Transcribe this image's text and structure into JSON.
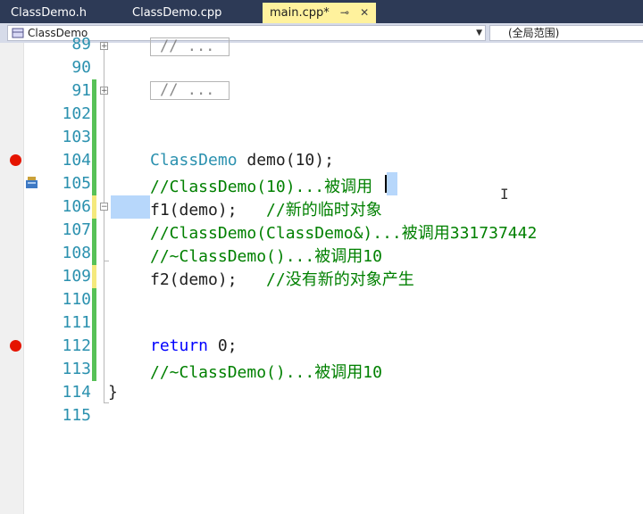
{
  "tabs": [
    {
      "label": "ClassDemo.h"
    },
    {
      "label": "ClassDemo.cpp"
    },
    {
      "label": "main.cpp*",
      "pin": "⊸",
      "close": "✕"
    }
  ],
  "nav": {
    "class_combo": "ClassDemo",
    "scope_combo": "(全局范围)"
  },
  "lines": {
    "l89": {
      "num": "89",
      "box": "// ..."
    },
    "l90": {
      "num": "90"
    },
    "l91": {
      "num": "91",
      "box": "// ..."
    },
    "l102": {
      "num": "102"
    },
    "l103": {
      "num": "103"
    },
    "l104": {
      "num": "104",
      "type": "ClassDemo",
      "rest": " demo(10);"
    },
    "l105": {
      "num": "105",
      "comment": "//ClassDemo(10)...被调用"
    },
    "l106": {
      "num": "106",
      "code": "f1(demo);   ",
      "comment": "//新的临时对象"
    },
    "l107": {
      "num": "107",
      "comment": "//ClassDemo(ClassDemo&)...被调用331737442"
    },
    "l108": {
      "num": "108",
      "comment": "//~ClassDemo()...被调用10"
    },
    "l109": {
      "num": "109",
      "code": "f2(demo);   ",
      "comment": "//没有新的对象产生"
    },
    "l110": {
      "num": "110"
    },
    "l111": {
      "num": "111"
    },
    "l112": {
      "num": "112",
      "keyword": "return",
      "rest": " 0;"
    },
    "l113": {
      "num": "113",
      "comment": "//~ClassDemo()...被调用10"
    },
    "l114": {
      "num": "114",
      "code": "}"
    },
    "l115": {
      "num": "115"
    }
  },
  "icons": {
    "breakpoint": "breakpoint-icon",
    "current_statement": "current-statement-icon",
    "fold_expand": "fold-expand-icon",
    "fold_collapse": "fold-collapse-icon",
    "text_cursor": "ibeam-cursor-icon"
  },
  "colors": {
    "tab_bar": "#2d3a56",
    "active_tab": "#fff29d",
    "line_number": "#2b91af",
    "comment": "#008000",
    "keyword": "#0000ff",
    "type": "#2b91af",
    "breakpoint": "#e51400",
    "saved_change": "#57c157",
    "unsaved_change": "#f5e97d"
  }
}
